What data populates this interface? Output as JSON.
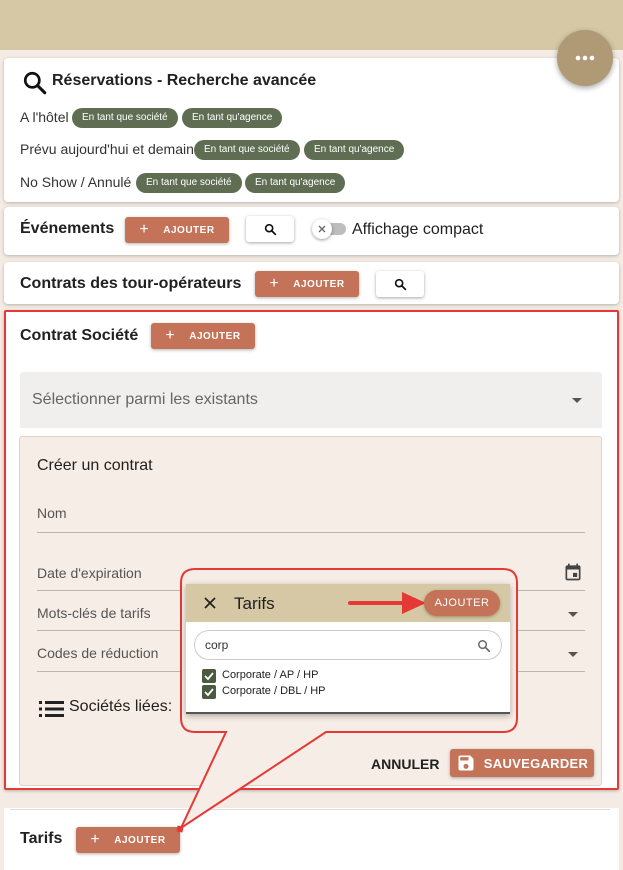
{
  "header": {
    "menu_icon": "more-horiz-icon"
  },
  "reservations": {
    "title": "Réservations - Recherche avancée",
    "rows": [
      {
        "label": "A l'hôtel",
        "chips": [
          "En tant que société",
          "En tant qu'agence"
        ]
      },
      {
        "label": "Prévu aujourd'hui et demain",
        "chips": [
          "En tant que société",
          "En tant qu'agence"
        ]
      },
      {
        "label": "No Show / Annulé",
        "chips": [
          "En tant que société",
          "En tant qu'agence"
        ]
      }
    ]
  },
  "evenements": {
    "title": "Événements",
    "add_label": "AJOUTER",
    "toggle_label": "Affichage compact",
    "toggle_on": false
  },
  "contrats_to": {
    "title": "Contrats des tour-opérateurs",
    "add_label": "AJOUTER"
  },
  "contrat_societe": {
    "title": "Contrat Société",
    "add_label": "AJOUTER",
    "select_placeholder": "Sélectionner parmi les existants",
    "create": {
      "title": "Créer un contrat",
      "nom_label": "Nom",
      "date_label": "Date d'expiration",
      "mots_cles_label": "Mots-clés de tarifs",
      "codes_label": "Codes de réduction",
      "societes_label": "Sociétés liées:"
    },
    "cancel_label": "ANNULER",
    "save_label": "SAUVEGARDER"
  },
  "tarifs_popup": {
    "title": "Tarifs",
    "add_label": "AJOUTER",
    "search_value": "corp",
    "options": [
      {
        "label": "Corporate / AP / HP",
        "checked": true
      },
      {
        "label": "Corporate / DBL / HP",
        "checked": true
      }
    ]
  },
  "tarifs": {
    "title": "Tarifs",
    "add_label": "AJOUTER"
  },
  "colors": {
    "accent": "#c47258",
    "chip": "#5f6e52",
    "highlight": "#e53935",
    "header": "#d6c8a4"
  }
}
